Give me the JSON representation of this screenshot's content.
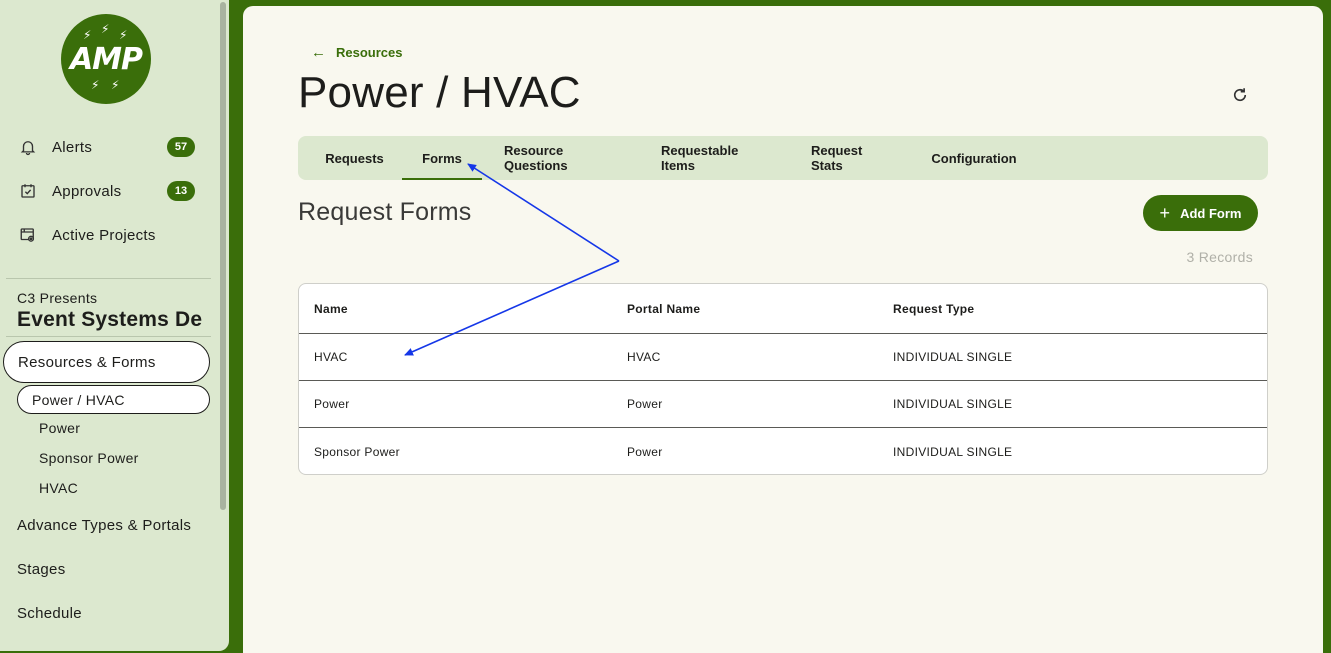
{
  "sidebar": {
    "logo_text": "AMP",
    "nav": [
      {
        "label": "Alerts",
        "badge": "57"
      },
      {
        "label": "Approvals",
        "badge": "13"
      },
      {
        "label": "Active Projects"
      }
    ],
    "org_subtitle": "C3 Presents",
    "org_title": "Event Systems De",
    "section_active": "Resources & Forms",
    "subsection_active": "Power / HVAC",
    "sub_items": [
      "Power",
      "Sponsor Power",
      "HVAC"
    ],
    "sections": [
      "Advance Types & Portals",
      "Stages",
      "Schedule"
    ]
  },
  "main": {
    "back_label": "Resources",
    "page_title": "Power / HVAC",
    "tabs": [
      "Requests",
      "Forms",
      "Resource Questions",
      "Requestable Items",
      "Request Stats",
      "Configuration"
    ],
    "active_tab": "Forms",
    "section_title": "Request Forms",
    "add_button_label": "Add Form",
    "records_count": "3 Records",
    "table": {
      "columns": [
        "Name",
        "Portal Name",
        "Request Type"
      ],
      "rows": [
        [
          "HVAC",
          "HVAC",
          "INDIVIDUAL SINGLE"
        ],
        [
          "Power",
          "Power",
          "INDIVIDUAL SINGLE"
        ],
        [
          "Sponsor Power",
          "Power",
          "INDIVIDUAL SINGLE"
        ]
      ]
    }
  },
  "colors": {
    "brand_green": "#3a6e0a",
    "sidebar_bg": "#dce8cf",
    "main_bg": "#f9f8ef",
    "annotation_blue": "#1537e8"
  }
}
